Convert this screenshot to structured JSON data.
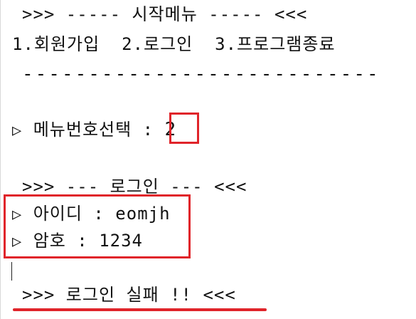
{
  "console": {
    "menu_title": ">>> ----- 시작메뉴 ----- <<<",
    "menu_options": "1.회원가입  2.로그인  3.프로그램종료",
    "separator": "---------------------------",
    "prompt_marker": "▷",
    "prompt_label": "메뉴번호선택 : ",
    "prompt_value": "2",
    "login_header": ">>> --- 로그인 --- <<<",
    "id_marker": "▷",
    "id_label": "아이디 : eomjh",
    "pw_marker": "▷",
    "pw_label": "암호 : 1234",
    "result": ">>> 로그인 실패 !! <<<"
  },
  "colors": {
    "highlight": "#e0242a",
    "text": "#111111",
    "background": "#ffffff"
  }
}
